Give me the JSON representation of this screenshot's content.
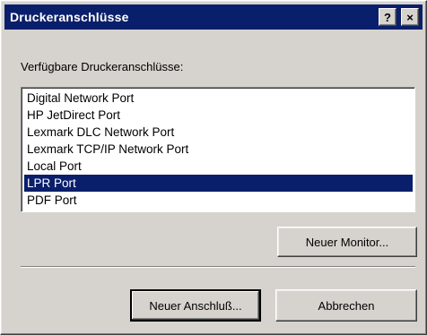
{
  "window": {
    "title": "Druckeranschlüsse",
    "help_button": "?",
    "close_button": "×"
  },
  "label": "Verfügbare Druckeranschlüsse:",
  "ports": [
    "Digital Network Port",
    "HP JetDirect Port",
    "Lexmark DLC Network Port",
    "Lexmark TCP/IP Network Port",
    "Local Port",
    "LPR Port",
    "PDF Port"
  ],
  "selected_port": "LPR Port",
  "buttons": {
    "new_monitor": "Neuer Monitor...",
    "new_port": "Neuer Anschluß...",
    "cancel": "Abbrechen"
  },
  "colors": {
    "titlebar": "#0a1f6b",
    "selection": "#0a1f6b",
    "dialog_face": "#d6d3ce"
  }
}
